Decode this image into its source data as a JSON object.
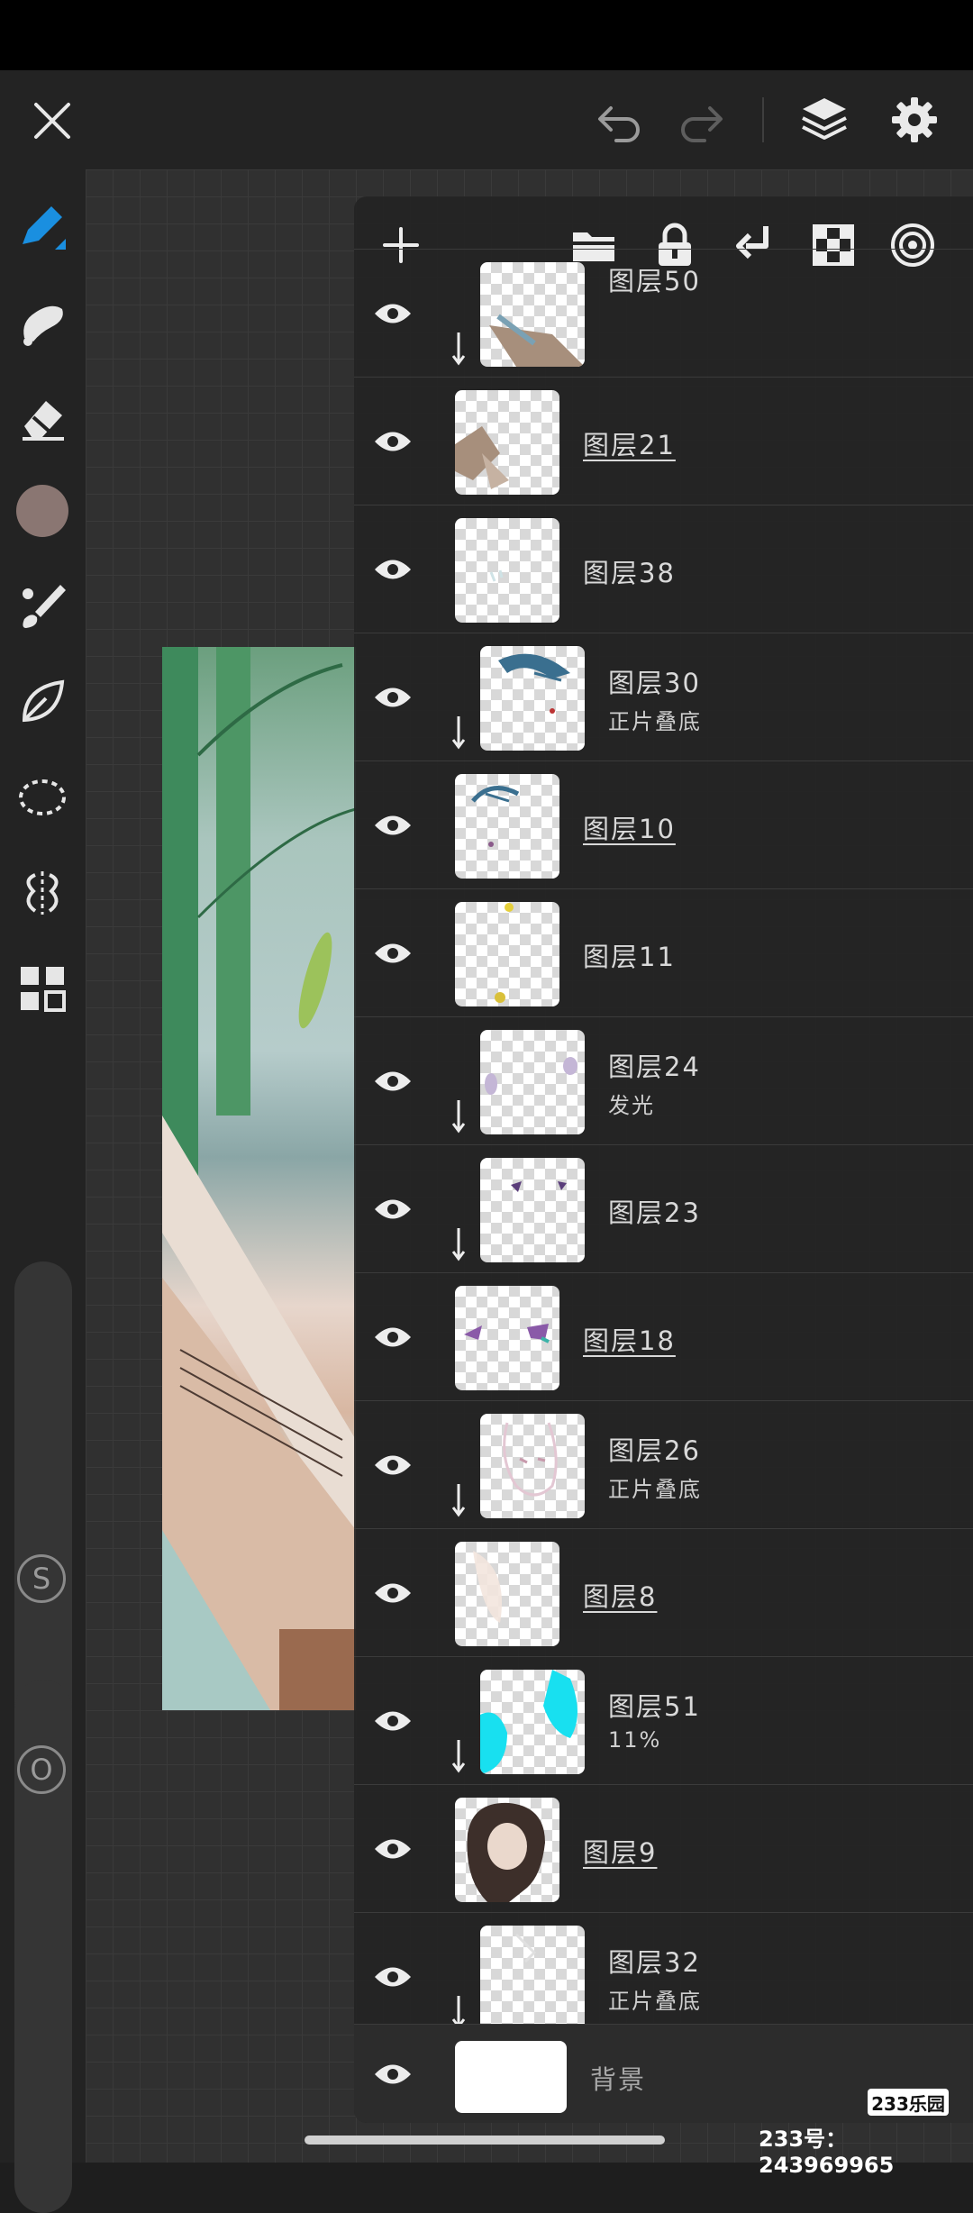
{
  "layers": [
    {
      "name": "图层50",
      "mode": "",
      "clipped": true
    },
    {
      "name": "图层21",
      "mode": "",
      "clipped": false
    },
    {
      "name": "图层38",
      "mode": "",
      "clipped": false
    },
    {
      "name": "图层30",
      "mode": "正片叠底",
      "clipped": true
    },
    {
      "name": "图层10",
      "mode": "",
      "clipped": false
    },
    {
      "name": "图层11",
      "mode": "",
      "clipped": false
    },
    {
      "name": "图层24",
      "mode": "发光",
      "clipped": true
    },
    {
      "name": "图层23",
      "mode": "",
      "clipped": true
    },
    {
      "name": "图层18",
      "mode": "",
      "clipped": false
    },
    {
      "name": "图层26",
      "mode": "正片叠底",
      "clipped": true
    },
    {
      "name": "图层8",
      "mode": "",
      "clipped": false
    },
    {
      "name": "图层51",
      "mode": "11%",
      "clipped": true
    },
    {
      "name": "图层9",
      "mode": "",
      "clipped": false
    },
    {
      "name": "图层32",
      "mode": "正片叠底",
      "clipped": true
    }
  ],
  "background_layer": {
    "name": "背景"
  },
  "sliders": {
    "size_label": "S",
    "opacity_label": "O"
  },
  "current_color": "#8a7672",
  "accent_color": "#1a8fe0",
  "watermark": {
    "logo": "233乐园",
    "id_text": "233号： 243969965"
  }
}
